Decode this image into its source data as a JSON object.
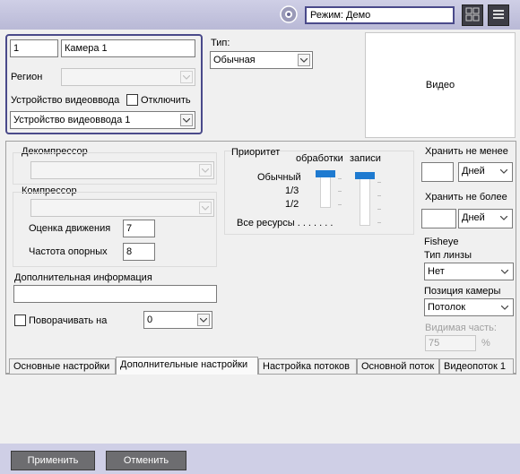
{
  "header": {
    "mode_label": "Режим: Демо",
    "layout_icon": "layout-grid-icon",
    "menu_icon": "menu-icon",
    "mode_icon": "mode-badge-icon"
  },
  "camera": {
    "id": "1",
    "name": "Камера 1",
    "region_label": "Регион",
    "region_value": "",
    "video_input_label": "Устройство видеоввода",
    "disable_label": "Отключить",
    "video_input_value": "Устройство видеоввода 1"
  },
  "type": {
    "label": "Тип:",
    "value": "Обычная"
  },
  "video_preview": {
    "label": "Видео"
  },
  "settings": {
    "decompressor_label": "Декомпрессор",
    "compressor_label": "Компрессор",
    "motion_label": "Оценка движения",
    "motion_value": "7",
    "keyframe_label": "Частота опорных",
    "keyframe_value": "8",
    "extra_info_label": "Дополнительная информация",
    "extra_info_value": "",
    "rotate_label": "Поворачивать на",
    "rotate_value": "0"
  },
  "priority": {
    "title": "Приоритет",
    "processing_label": "обработки",
    "recording_label": "записи",
    "levels": [
      "Обычный",
      "1/3",
      "1/2",
      "Все ресурсы . . . . . . ."
    ],
    "processing_level": 0,
    "recording_level": 0
  },
  "storage": {
    "min_label": "Хранить не менее",
    "min_value": "",
    "min_unit": "Дней",
    "max_label": "Хранить не более",
    "max_value": "",
    "max_unit": "Дней"
  },
  "fisheye": {
    "title": "Fisheye",
    "lens_label": "Тип линзы",
    "lens_value": "Нет",
    "position_label": "Позиция камеры",
    "position_value": "Потолок",
    "visible_label": "Видимая часть:",
    "visible_value": "75",
    "visible_unit": "%"
  },
  "tabs": [
    {
      "label": "Основные настройки"
    },
    {
      "label": "Дополнительные настройки"
    },
    {
      "label": "Настройка потоков"
    },
    {
      "label": "Основной поток"
    },
    {
      "label": "Видеопоток 1"
    }
  ],
  "buttons": {
    "apply": "Применить",
    "cancel": "Отменить"
  },
  "colors": {
    "accent": "#4a4a8a",
    "slider": "#1e7ad0",
    "button": "#6d6d70"
  }
}
